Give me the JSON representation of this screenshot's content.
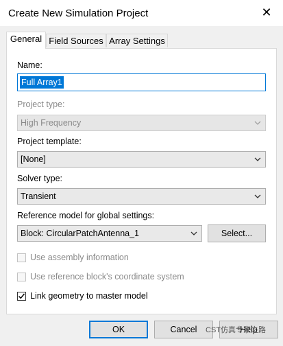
{
  "window": {
    "title": "Create New Simulation Project"
  },
  "tabs": [
    {
      "label": "General",
      "active": true
    },
    {
      "label": "Field Sources",
      "active": false
    },
    {
      "label": "Array Settings",
      "active": false
    }
  ],
  "general": {
    "name_label": "Name:",
    "name_value": "Full Array1",
    "project_type_label": "Project type:",
    "project_type_value": "High Frequency",
    "project_template_label": "Project template:",
    "project_template_value": "[None]",
    "solver_type_label": "Solver type:",
    "solver_type_value": "Transient",
    "reference_model_label": "Reference model for global settings:",
    "reference_model_value": "Block: CircularPatchAntenna_1",
    "select_button": "Select...",
    "checkboxes": [
      {
        "label": "Use assembly information",
        "checked": false,
        "enabled": false
      },
      {
        "label": "Use reference block's coordinate system",
        "checked": false,
        "enabled": false
      },
      {
        "label": "Link geometry to master model",
        "checked": true,
        "enabled": true
      }
    ]
  },
  "buttons": {
    "ok": "OK",
    "cancel": "Cancel",
    "help": "Help"
  },
  "watermark": "CST仿真专家之路",
  "colors": {
    "accent": "#0078d7",
    "disabled_text": "#8a8a8a",
    "dialog_bg": "#f0f0f0"
  }
}
